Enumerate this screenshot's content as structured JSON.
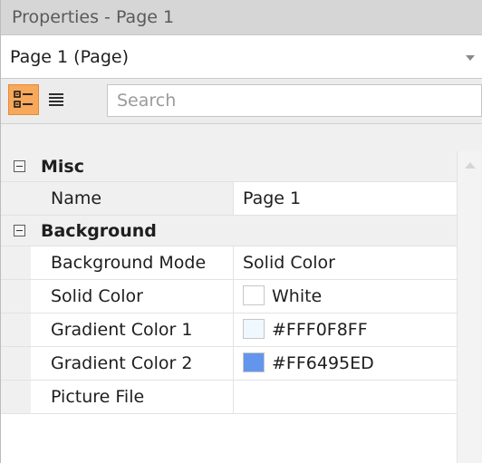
{
  "title": "Properties - Page 1",
  "object_selector": {
    "value": "Page 1 (Page)"
  },
  "toolbar": {
    "categorized_icon": "categorized-view-icon",
    "alphabetical_icon": "alphabetical-view-icon",
    "search_placeholder": "Search"
  },
  "categories": [
    {
      "label": "Misc",
      "rows": [
        {
          "name": "Name",
          "value": "Page 1"
        }
      ]
    },
    {
      "label": "Background",
      "rows": [
        {
          "name": "Background Mode",
          "value": "Solid Color"
        },
        {
          "name": "Solid Color",
          "value": "White",
          "swatch": "#FFFFFF"
        },
        {
          "name": "Gradient Color 1",
          "value": "#FFF0F8FF",
          "swatch": "#F0F8FF"
        },
        {
          "name": "Gradient Color 2",
          "value": "#FF6495ED",
          "swatch": "#6495ED"
        },
        {
          "name": "Picture File",
          "value": ""
        }
      ]
    }
  ],
  "colors": {
    "active_toolbar_button": "#F7A85A",
    "title_bar": "#D6D6D6"
  }
}
